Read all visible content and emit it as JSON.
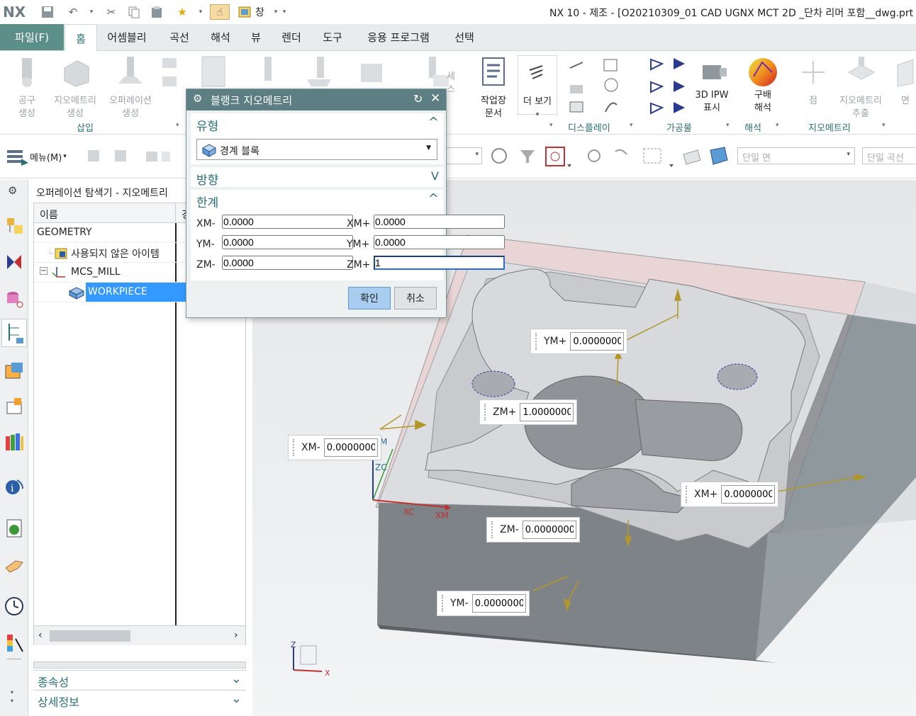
{
  "titlebar": {
    "logo": "NX",
    "window_menu": "창",
    "title": "NX 10 - 제조 - [O20210309_01 CAD UGNX MCT 2D _단차 리머 포함__dwg.prt"
  },
  "ribbon_tabs": {
    "file": "파일(F)",
    "tabs": [
      "홈",
      "어셈블리",
      "곡선",
      "해석",
      "뷰",
      "렌더",
      "도구",
      "응용 프로그램",
      "선택"
    ]
  },
  "ribbon": {
    "tool_create": "공구\n생성",
    "geometry_create": "지오메트리\n생성",
    "operation_create": "오퍼레이션\n생성",
    "insert_group": "삽입",
    "process_partial": "세스",
    "shop_doc": "작업장\n문서",
    "more": "더 보기",
    "display_group": "디스플레이",
    "ipw": "3D IPW\n표시",
    "workpiece_group": "가공물",
    "gradient": "구배\n해석",
    "analysis_group": "해석",
    "point": "점",
    "extract_geo": "지오메트리\n추출",
    "geometry_group": "지오메트리",
    "face": "면"
  },
  "toolbar": {
    "menu": "메뉴(M)",
    "filter_face": "단일 면",
    "filter_curve": "단일 곡선"
  },
  "navigator": {
    "title": "오퍼레이션 탐색기 - 지오메트리",
    "col_name": "이름",
    "col_2": "경",
    "rows": [
      "GEOMETRY",
      "사용되지 않은 아이템",
      "MCS_MILL",
      "WORKPIECE"
    ],
    "sec_dependencies": "종속성",
    "sec_details": "상세정보"
  },
  "dialog": {
    "title": "블랭크 지오메트리",
    "type_header": "유형",
    "type_value": "경계 블록",
    "direction_header": "방향",
    "limits_header": "한계",
    "xm_minus_label": "XM-",
    "xm_minus": "0.0000",
    "xm_plus_label": "XM+",
    "xm_plus": "0.0000",
    "ym_minus_label": "YM-",
    "ym_minus": "0.0000",
    "ym_plus_label": "YM+",
    "ym_plus": "0.0000",
    "zm_minus_label": "ZM-",
    "zm_minus": "0.0000",
    "zm_plus_label": "ZM+",
    "zm_plus": "1",
    "ok": "확인",
    "cancel": "취소"
  },
  "viewport": {
    "ym_plus": {
      "label": "YM+",
      "value": "0.0000000"
    },
    "zm_plus": {
      "label": "ZM+",
      "value": "1.0000000"
    },
    "xm_minus": {
      "label": "XM-",
      "value": "0.0000000"
    },
    "xm_plus": {
      "label": "XM+",
      "value": "0.0000000"
    },
    "zm_minus": {
      "label": "ZM-",
      "value": "0.0000000"
    },
    "ym_minus": {
      "label": "YM-",
      "value": "0.0000000"
    },
    "axis_xc": "XC",
    "axis_xm": "XM",
    "axis_zc": "ZC",
    "axis_m": "M",
    "triad_z": "Z",
    "triad_x": "X"
  },
  "colors": {
    "accent": "#2a6f73",
    "file_tab": "#5d8f8a",
    "dialog_title": "#5d7f83",
    "selection": "#3399ff"
  }
}
